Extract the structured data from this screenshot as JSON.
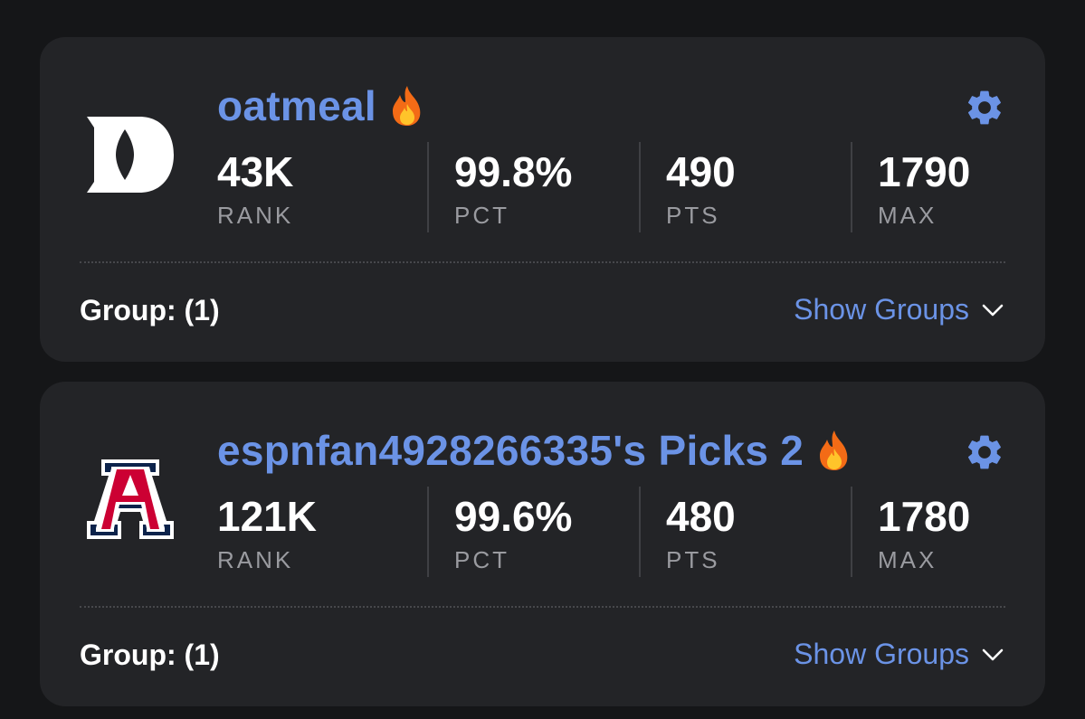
{
  "colors": {
    "background": "#151618",
    "card": "#232427",
    "accent": "#6b93e6",
    "text_primary": "#ffffff",
    "text_secondary": "#9a9ba0"
  },
  "entries": [
    {
      "logo": "duke-d-logo",
      "title": "oatmeal",
      "badge_icon": "fire-icon",
      "settings_icon": "gear-icon",
      "stats": [
        {
          "value": "43K",
          "label": "RANK"
        },
        {
          "value": "99.8%",
          "label": "PCT"
        },
        {
          "value": "490",
          "label": "PTS"
        },
        {
          "value": "1790",
          "label": "MAX"
        }
      ],
      "group_label": "Group: (1)",
      "show_groups_label": "Show Groups",
      "show_groups_icon": "chevron-down-icon"
    },
    {
      "logo": "arizona-a-logo",
      "title": "espnfan4928266335's Picks 2",
      "badge_icon": "fire-icon",
      "settings_icon": "gear-icon",
      "stats": [
        {
          "value": "121K",
          "label": "RANK"
        },
        {
          "value": "99.6%",
          "label": "PCT"
        },
        {
          "value": "480",
          "label": "PTS"
        },
        {
          "value": "1780",
          "label": "MAX"
        }
      ],
      "group_label": "Group: (1)",
      "show_groups_label": "Show Groups",
      "show_groups_icon": "chevron-down-icon"
    }
  ]
}
